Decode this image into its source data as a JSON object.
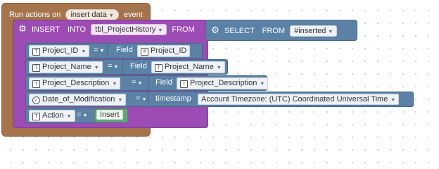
{
  "trigger": {
    "prefix": "Run actions on",
    "event_value": "insert data",
    "suffix": "event"
  },
  "insert_block": {
    "prefix": "INSERT",
    "into_label": "INTO",
    "table_value": "tbl_ProjectHistory",
    "from_label": "FROM"
  },
  "select_block": {
    "label": "SELECT",
    "from_label": "FROM",
    "source_value": "#inserted"
  },
  "rows": [
    {
      "column": "Project_ID",
      "eq": "=",
      "value_kind": "Field",
      "value": "Project_ID"
    },
    {
      "column": "Project_Name",
      "eq": "=",
      "value_kind": "Field",
      "value": "Project_Name"
    },
    {
      "column": "Project_Description",
      "eq": "=",
      "value_kind": "Field",
      "value": "Project_Description"
    },
    {
      "column": "Date_of_Modification",
      "eq": "=",
      "value_kind": "timestamp",
      "value": "Account Timezone: (UTC) Coordinated Universal Time"
    },
    {
      "column": "Action",
      "eq": "=",
      "value_kind": "",
      "value": "Insert"
    }
  ],
  "colors": {
    "trigger": "#a5744d",
    "insert": "#9c4cb4",
    "blue": "#5b81a6",
    "green": "#5ea87a"
  }
}
